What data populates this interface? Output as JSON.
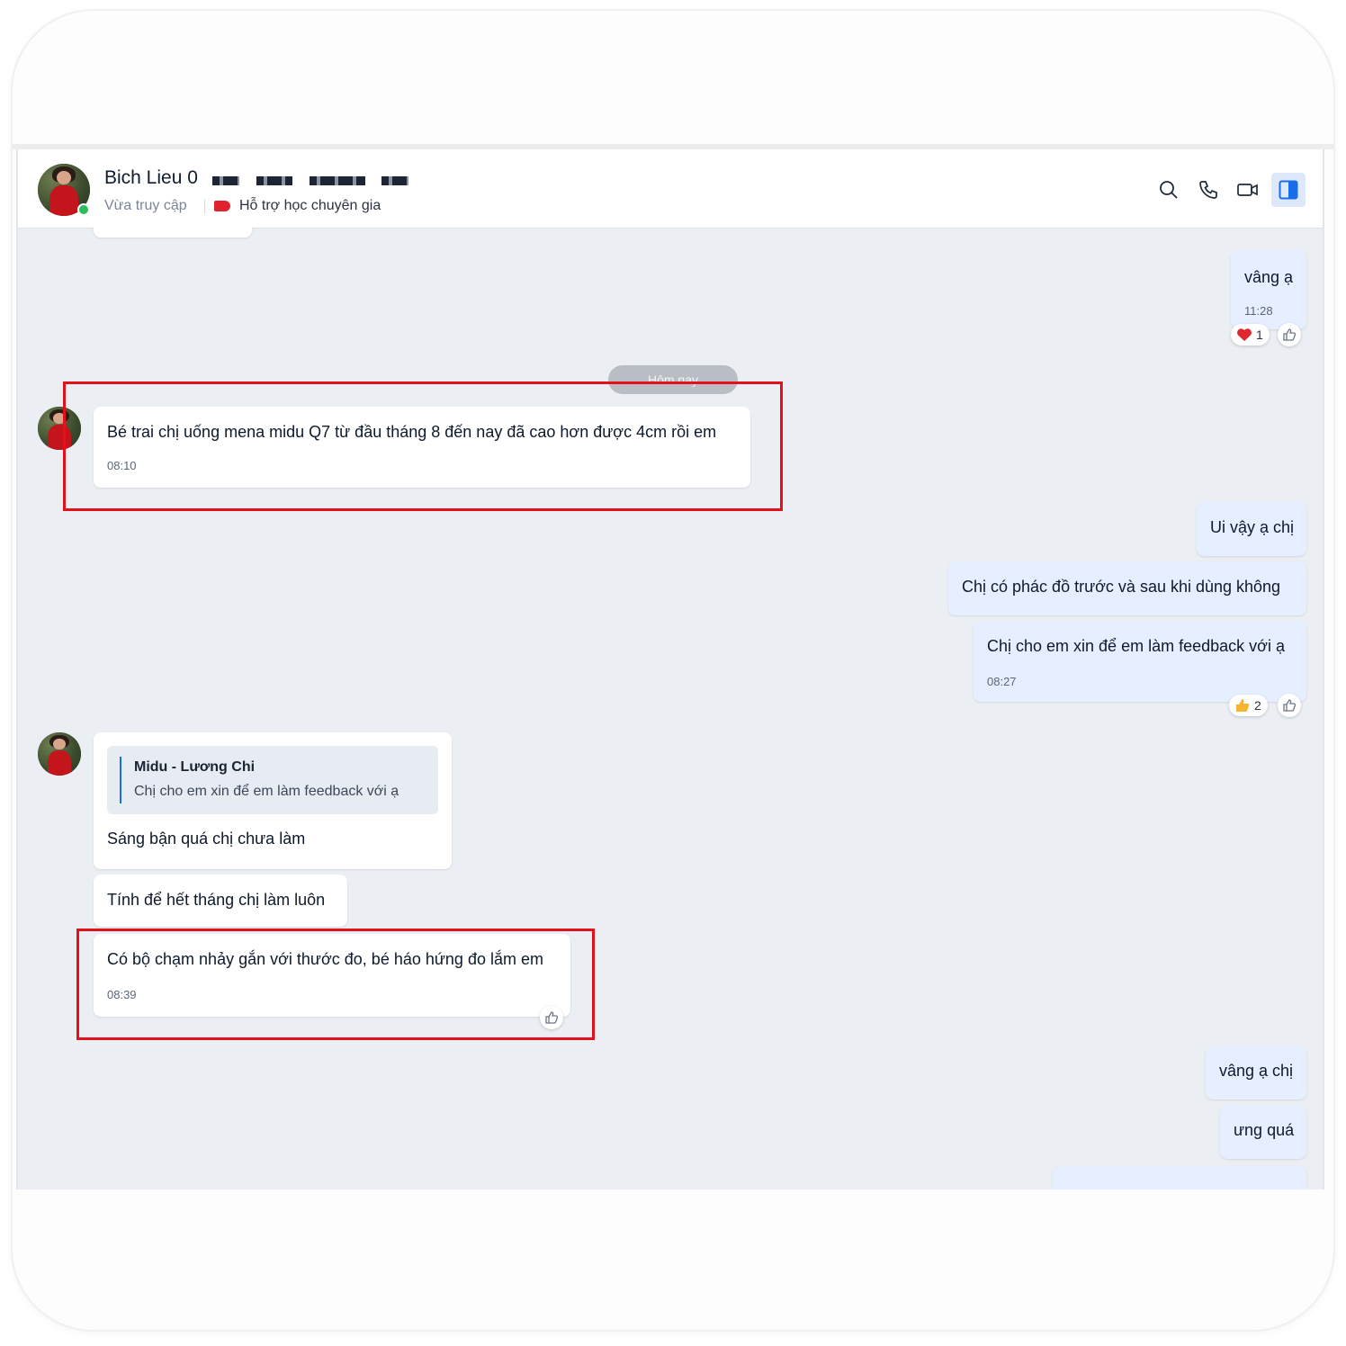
{
  "header": {
    "contact_name": "Bich Lieu 0",
    "status": "Vừa truy cập",
    "tag_label": "Hỗ trợ học chuyên gia"
  },
  "icons": {
    "search": "search-icon",
    "call": "phone-icon",
    "video": "video-camera-icon",
    "panel": "sidebar-toggle-icon",
    "like": "thumbs-up-icon",
    "heart": "heart-icon",
    "thumbs_reaction": "thumbs-up-emoji-icon"
  },
  "colors": {
    "highlight": "#e3111b",
    "accent": "#1a6dea",
    "my_bubble": "#e5efff",
    "chat_bg": "#ebeef2"
  },
  "date_divider": "Hôm nay",
  "messages": {
    "m1": {
      "text": "vâng ạ",
      "time": "11:28",
      "reaction_count": "1"
    },
    "m2": {
      "text": "Bé trai chị uống mena midu Q7 từ đầu tháng 8 đến nay đã cao hơn được 4cm rồi em",
      "time": "08:10"
    },
    "m3": {
      "text": "Ui vậy ạ chị"
    },
    "m4": {
      "text": "Chị có phác đồ trước và sau khi dùng không"
    },
    "m5": {
      "text": "Chị cho em xin để em làm feedback với ạ",
      "time": "08:27",
      "reaction_count": "2"
    },
    "m6": {
      "quote_author": "Midu - Lương Chi",
      "quote_text": "Chị cho em xin để em làm feedback với ạ",
      "text": "Sáng bận quá chị chưa làm"
    },
    "m7": {
      "text": "Tính để hết tháng chị làm luôn"
    },
    "m8": {
      "text": "Có bộ chạm nhảy gắn với thước đo, bé háo hứng đo lắm em",
      "time": "08:39"
    },
    "m9": {
      "text": "vâng ạ chị"
    },
    "m10": {
      "text": "ưng quá"
    }
  }
}
